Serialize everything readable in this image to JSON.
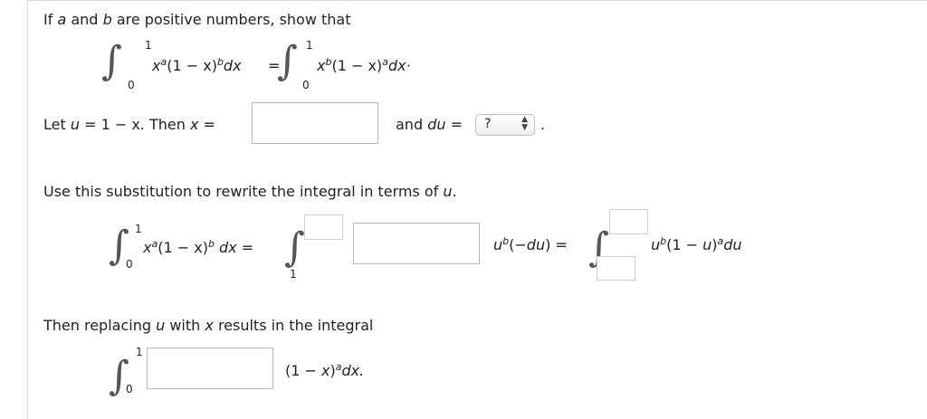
{
  "prompt": {
    "if": "If",
    "a": "a",
    "and": "and",
    "b": "b",
    "rest": "are positive numbers, show that"
  },
  "identity": {
    "lower": "0",
    "upper": "1",
    "left_x": "x",
    "left_a": "a",
    "left_mid": "(1 − x)",
    "left_b": "b",
    "left_dx": "dx",
    "equals": "=",
    "right_x": "x",
    "right_b": "b",
    "right_mid": "(1 − x)",
    "right_a": "a",
    "right_dx": "dx·"
  },
  "let_line": {
    "let": "Let",
    "u": "u",
    "eq_expr": "= 1 − x. Then",
    "x": "x",
    "equals": "=",
    "and": "and",
    "du": "du",
    "equals2": "=",
    "select_value": "?",
    "period": "."
  },
  "instruction": {
    "text1": "Use this substitution to rewrite the integral in terms of",
    "u": "u",
    "dot": "."
  },
  "rewrite": {
    "lower0": "0",
    "upper1": "1",
    "x": "x",
    "a": "a",
    "mid": "(1 − x)",
    "b": "b",
    "dx": "dx",
    "equals": "=",
    "lower1": "1",
    "u1": "u",
    "b2": "b",
    "tail1": "(−",
    "du": "du",
    "tail2": ")",
    "equals2": "=",
    "u2": "u",
    "b3": "b",
    "mid2": "(1 − ",
    "u3": "u",
    "close": ")",
    "a2": "a",
    "du2": "du"
  },
  "replace": {
    "text1": "Then replacing",
    "u": "u",
    "with": "with",
    "x": "x",
    "text2": "results in the integral"
  },
  "final": {
    "lower": "0",
    "upper": "1",
    "expr1": "(1 − ",
    "x": "x",
    "close": ")",
    "a": "a",
    "dx": "dx."
  }
}
